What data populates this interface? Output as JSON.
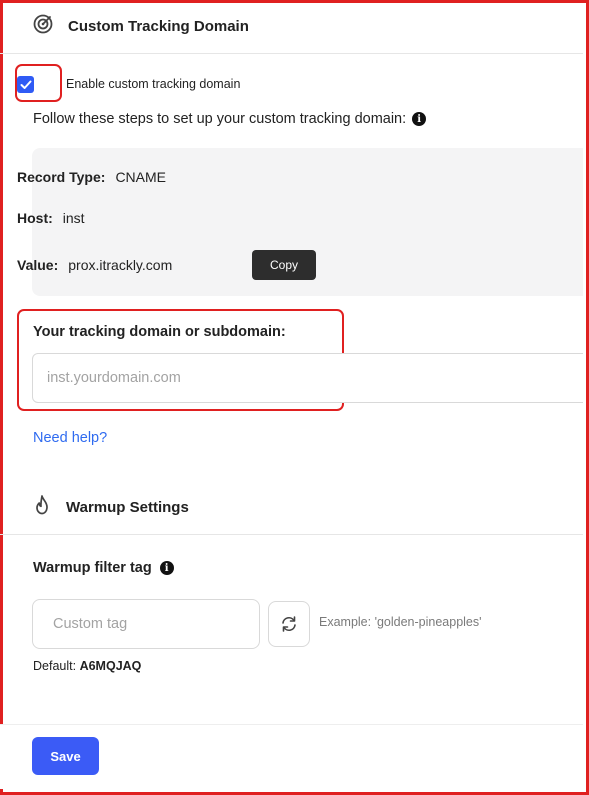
{
  "tracking": {
    "title": "Custom Tracking Domain",
    "icon": "target-icon",
    "checkbox_label": "Enable custom tracking domain",
    "checkbox_checked": true,
    "instructions": "Follow these steps to set up your custom tracking domain:",
    "record": {
      "type_key": "Record Type:",
      "type_value": "CNAME",
      "host_key": "Host:",
      "host_value": "inst",
      "value_key": "Value:",
      "value_value": "prox.itrackly.com",
      "copy_label": "Copy"
    },
    "domain_label": "Your tracking domain or subdomain:",
    "domain_placeholder": "inst.yourdomain.com",
    "domain_value": "",
    "help_link": "Need help?"
  },
  "warmup": {
    "title": "Warmup Settings",
    "icon": "flame-icon",
    "filter_label": "Warmup filter tag",
    "tag_placeholder": "Custom tag",
    "tag_value": "",
    "example": "Example: 'golden-pineapples'",
    "default_prefix": "Default:",
    "default_value": "A6MQJAQ"
  },
  "footer": {
    "save_label": "Save"
  },
  "colors": {
    "accent": "#3b5bf6",
    "highlight": "#e02020",
    "link": "#2f6bf0"
  }
}
